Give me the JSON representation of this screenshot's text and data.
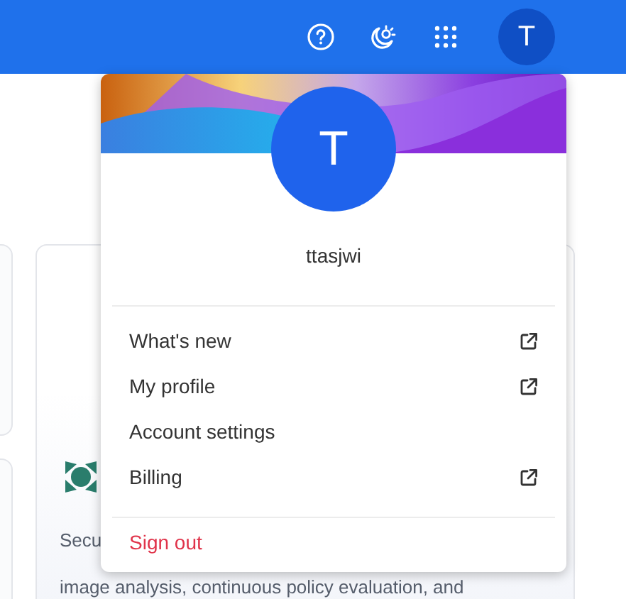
{
  "top_bar": {
    "icons": [
      {
        "kind": "help"
      },
      {
        "kind": "theme"
      },
      {
        "kind": "apps"
      }
    ],
    "avatar_initial": "T"
  },
  "background_card": {
    "text_start": "Secu",
    "text_line": "image analysis, continuous policy evaluation, and"
  },
  "account_menu": {
    "avatar_initial": "T",
    "username": "ttasjwi",
    "items": [
      {
        "label": "What's new",
        "external": true
      },
      {
        "label": "My profile",
        "external": true
      },
      {
        "label": "Account settings",
        "external": false
      },
      {
        "label": "Billing",
        "external": true
      }
    ],
    "sign_out": "Sign out"
  }
}
